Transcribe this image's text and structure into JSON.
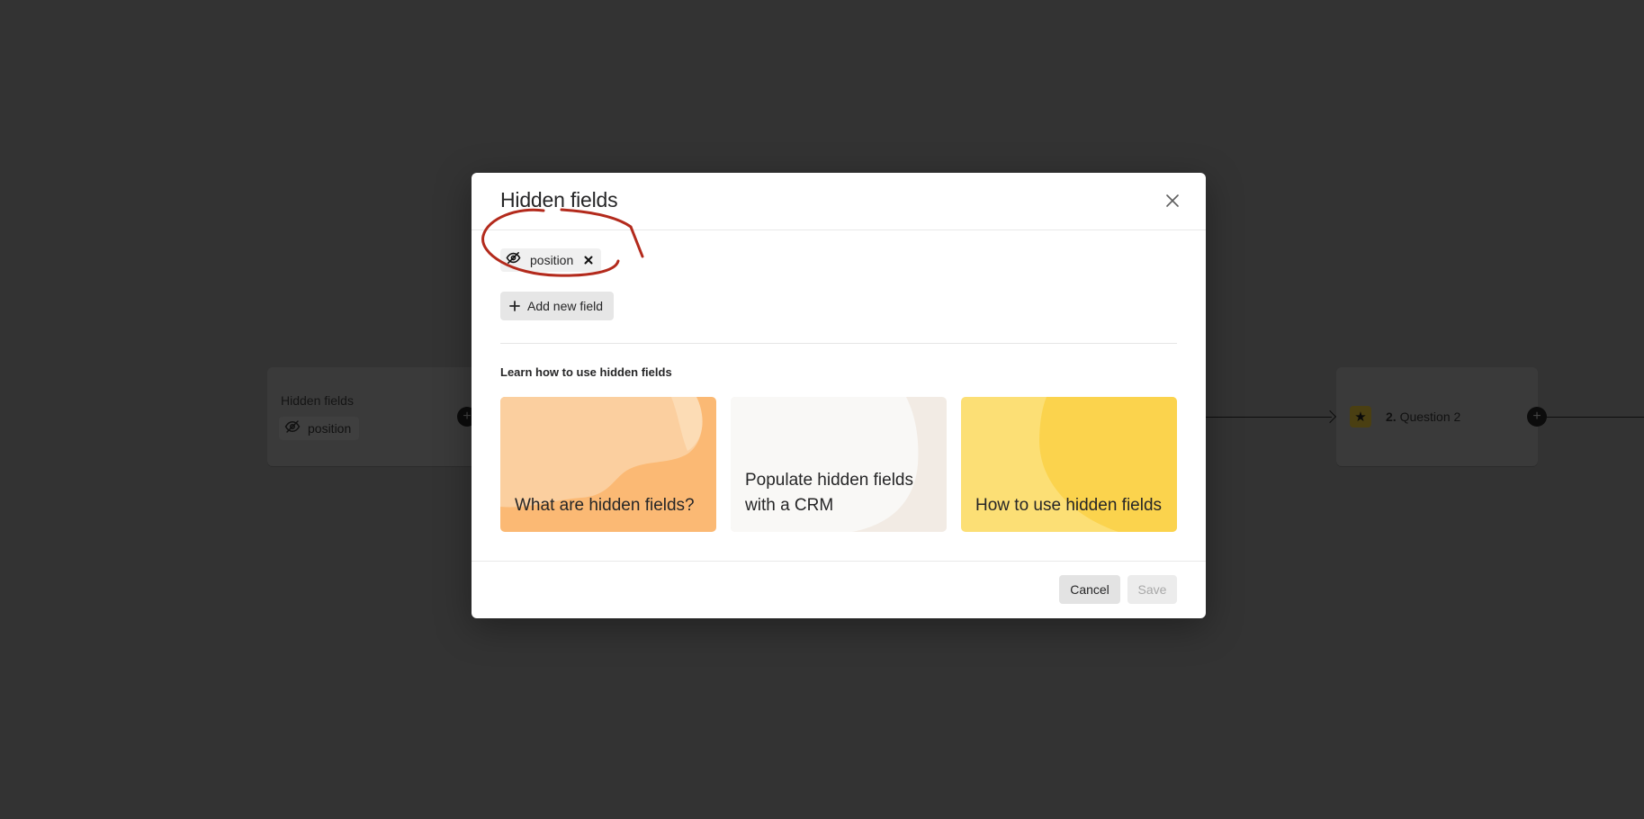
{
  "background": {
    "left_card": {
      "title": "Hidden fields",
      "pill_label": "position",
      "pill_icon": "eye-slash-icon"
    },
    "right_card": {
      "question_icon": "star-icon",
      "question_number": "2.",
      "question_label": "Question 2"
    },
    "connector_icon": "plus-icon"
  },
  "modal": {
    "title": "Hidden fields",
    "close_icon": "close-icon",
    "fields": [
      {
        "label": "position",
        "icon": "eye-slash-icon",
        "remove_icon": "x-icon"
      }
    ],
    "add_button": {
      "label": "Add new field",
      "icon": "plus-icon"
    },
    "learn_heading": "Learn how to use hidden fields",
    "resources": [
      {
        "title": "What are hidden fields?",
        "colors": [
          "#fbb36b",
          "#fbcf9f",
          "#fbb974"
        ]
      },
      {
        "title": "Populate hidden fields with a CRM",
        "colors": [
          "#f2ebe4",
          "#f9f8f6"
        ]
      },
      {
        "title": "How to use hidden fields",
        "colors": [
          "#fbd34d",
          "#fcdf75"
        ]
      }
    ],
    "footer": {
      "cancel_label": "Cancel",
      "save_label": "Save",
      "save_disabled": true
    },
    "annotation_color": "#b32a1c"
  }
}
